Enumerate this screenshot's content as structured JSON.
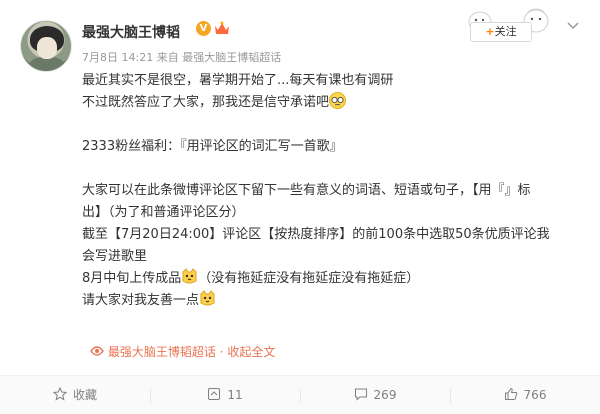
{
  "header": {
    "user_name": "最强大脑王博韬",
    "verified_badge": "V",
    "date": "7月8日 14:21",
    "source_prefix": "来自",
    "source_name": "最强大脑王博韬超话"
  },
  "follow_button": {
    "plus": "+",
    "label": "关注"
  },
  "post": {
    "lines": [
      "最近其实不是很空，暑学期开始了...每天有课也有调研",
      "不过既然答应了大家，那我还是信守承诺吧",
      "",
      "2333粉丝福利：『用评论区的词汇写一首歌』",
      "",
      "大家可以在此条微博评论区下留下一些有意义的词语、短语或句子，【用『』标",
      "出】（为了和普通评论区分）",
      "截至【7月20日24:00】评论区【按热度排序】的前100条中选取50条优质评论我",
      "会写进歌里",
      "8月中旬上传成品",
      "（没有拖延症没有拖延症没有拖延症）",
      "请大家对我友善一点"
    ]
  },
  "fulltext_link": {
    "topic": "最强大脑王博韬超话",
    "label": "收起全文"
  },
  "actions": {
    "favorite": "收藏",
    "repost_count": "11",
    "comment_count": "269",
    "like_count": "766"
  },
  "colors": {
    "accent": "#ff8200",
    "link": "#eb7350",
    "muted": "#999999"
  },
  "icons": [
    "avatar",
    "verified-icon",
    "crown-icon",
    "chevron-down-icon",
    "sleepy-emoji-icon",
    "cat-emoji-icon",
    "supertopic-icon",
    "favorite-icon",
    "repost-icon",
    "comment-icon",
    "like-icon"
  ]
}
